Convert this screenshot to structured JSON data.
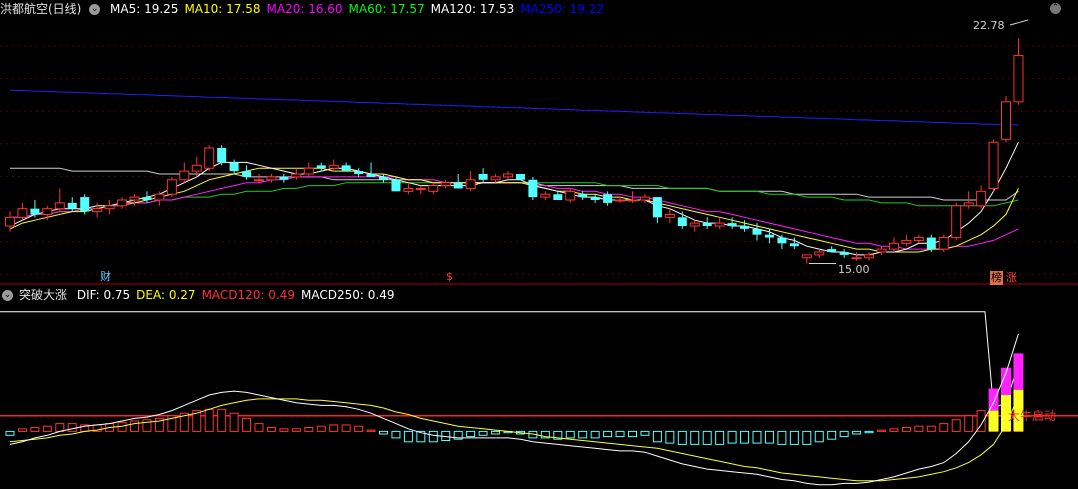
{
  "header": {
    "title": "洪都航空(日线)",
    "ma": [
      {
        "label": "MA5: 19.25",
        "color": "#ffffff"
      },
      {
        "label": "MA10: 17.58",
        "color": "#ffff00"
      },
      {
        "label": "MA20: 16.60",
        "color": "#ff00ff"
      },
      {
        "label": "MA60: 17.57",
        "color": "#00ff00"
      },
      {
        "label": "MA120: 17.53",
        "color": "#ffffff"
      },
      {
        "label": "MA250: 19.22",
        "color": "#0000ff"
      }
    ]
  },
  "indicator": {
    "title": "突破大涨",
    "items": [
      {
        "label": "DIF: 0.75",
        "color": "#ffffff"
      },
      {
        "label": "DEA: 0.27",
        "color": "#ffff00"
      },
      {
        "label": "MACD120: 0.49",
        "color": "#ff3030"
      },
      {
        "label": "MACD250: 0.49",
        "color": "#ffffff"
      }
    ]
  },
  "annotations": {
    "high": "22.78",
    "low": "15.00",
    "cai": "财",
    "dollar": "$",
    "bang": "榜",
    "zhang": "涨",
    "signal": "大牛启动"
  },
  "colors": {
    "up": "#ff3232",
    "down": "#54ffff",
    "grid": "#5a0000",
    "divider": "#b00000"
  },
  "chart_data": {
    "type": "candlestick",
    "ylim": [
      14.5,
      23.5
    ],
    "candles": [
      [
        16.3,
        16.8,
        16.1,
        16.6
      ],
      [
        16.6,
        17.1,
        16.5,
        16.9
      ],
      [
        16.9,
        17.2,
        16.6,
        16.7
      ],
      [
        16.7,
        17.0,
        16.5,
        16.9
      ],
      [
        16.9,
        17.6,
        16.8,
        17.1
      ],
      [
        17.1,
        17.3,
        16.8,
        16.9
      ],
      [
        17.3,
        17.4,
        16.7,
        16.8
      ],
      [
        16.8,
        17.1,
        16.6,
        16.9
      ],
      [
        16.9,
        17.2,
        16.7,
        17.0
      ],
      [
        17.0,
        17.3,
        16.9,
        17.2
      ],
      [
        17.2,
        17.4,
        17.0,
        17.3
      ],
      [
        17.3,
        17.5,
        17.1,
        17.2
      ],
      [
        17.2,
        17.5,
        17.0,
        17.4
      ],
      [
        17.4,
        18.0,
        17.3,
        17.9
      ],
      [
        17.9,
        18.5,
        17.8,
        18.2
      ],
      [
        18.2,
        18.7,
        18.0,
        18.4
      ],
      [
        18.3,
        19.1,
        18.2,
        19.0
      ],
      [
        19.0,
        19.1,
        18.4,
        18.5
      ],
      [
        18.5,
        18.6,
        18.1,
        18.2
      ],
      [
        18.2,
        18.4,
        17.9,
        18.0
      ],
      [
        17.9,
        18.1,
        17.8,
        17.9
      ],
      [
        17.9,
        18.1,
        17.8,
        18.0
      ],
      [
        18.0,
        18.1,
        17.8,
        17.9
      ],
      [
        18.0,
        18.3,
        17.9,
        18.1
      ],
      [
        18.1,
        18.5,
        18.0,
        18.3
      ],
      [
        18.4,
        18.5,
        18.2,
        18.3
      ],
      [
        18.3,
        18.6,
        18.2,
        18.4
      ],
      [
        18.4,
        18.5,
        18.2,
        18.2
      ],
      [
        18.2,
        18.3,
        18.0,
        18.1
      ],
      [
        18.1,
        18.5,
        18.0,
        18.0
      ],
      [
        18.0,
        18.1,
        17.8,
        17.9
      ],
      [
        17.9,
        18.0,
        17.5,
        17.5
      ],
      [
        17.5,
        17.8,
        17.4,
        17.6
      ],
      [
        17.6,
        17.7,
        17.4,
        17.6
      ],
      [
        17.5,
        17.8,
        17.4,
        17.7
      ],
      [
        17.7,
        17.9,
        17.6,
        17.8
      ],
      [
        17.8,
        18.1,
        17.6,
        17.6
      ],
      [
        17.6,
        18.2,
        17.5,
        17.9
      ],
      [
        18.1,
        18.3,
        17.8,
        17.9
      ],
      [
        17.9,
        18.1,
        17.8,
        18.0
      ],
      [
        18.0,
        18.2,
        17.9,
        18.1
      ],
      [
        18.1,
        18.1,
        17.9,
        17.9
      ],
      [
        17.9,
        18.0,
        17.2,
        17.3
      ],
      [
        17.3,
        17.5,
        17.2,
        17.4
      ],
      [
        17.4,
        17.5,
        17.2,
        17.2
      ],
      [
        17.2,
        17.6,
        17.1,
        17.5
      ],
      [
        17.4,
        17.5,
        17.2,
        17.3
      ],
      [
        17.3,
        17.4,
        17.1,
        17.2
      ],
      [
        17.4,
        17.5,
        17.0,
        17.1
      ],
      [
        17.2,
        17.3,
        17.1,
        17.2
      ],
      [
        17.2,
        17.5,
        17.1,
        17.2
      ],
      [
        17.2,
        17.4,
        17.1,
        17.3
      ],
      [
        17.3,
        17.3,
        16.4,
        16.6
      ],
      [
        16.6,
        16.9,
        16.4,
        16.7
      ],
      [
        16.6,
        16.8,
        16.2,
        16.3
      ],
      [
        16.3,
        16.5,
        16.1,
        16.4
      ],
      [
        16.4,
        16.6,
        16.2,
        16.3
      ],
      [
        16.3,
        16.6,
        16.2,
        16.4
      ],
      [
        16.4,
        16.6,
        16.2,
        16.3
      ],
      [
        16.3,
        16.5,
        16.1,
        16.2
      ],
      [
        16.2,
        16.4,
        15.8,
        16.0
      ],
      [
        16.0,
        16.2,
        15.7,
        15.9
      ],
      [
        15.9,
        16.0,
        15.5,
        15.7
      ],
      [
        15.7,
        15.9,
        15.5,
        15.6
      ],
      [
        15.2,
        15.3,
        15.0,
        15.3
      ],
      [
        15.3,
        15.5,
        15.2,
        15.4
      ],
      [
        15.5,
        15.6,
        15.4,
        15.4
      ],
      [
        15.4,
        15.5,
        15.2,
        15.3
      ],
      [
        15.2,
        15.4,
        15.1,
        15.2
      ],
      [
        15.2,
        15.4,
        15.1,
        15.3
      ],
      [
        15.4,
        15.6,
        15.3,
        15.5
      ],
      [
        15.5,
        15.9,
        15.4,
        15.7
      ],
      [
        15.7,
        16.0,
        15.6,
        15.8
      ],
      [
        15.8,
        16.0,
        15.7,
        15.9
      ],
      [
        15.9,
        16.0,
        15.4,
        15.5
      ],
      [
        15.5,
        16.0,
        15.4,
        15.9
      ],
      [
        15.9,
        17.1,
        15.8,
        17.0
      ],
      [
        17.0,
        17.5,
        16.9,
        17.1
      ],
      [
        17.0,
        17.7,
        16.9,
        17.5
      ],
      [
        17.6,
        19.3,
        17.5,
        19.2
      ],
      [
        19.3,
        20.8,
        19.2,
        20.6
      ],
      [
        20.6,
        22.8,
        20.5,
        22.2
      ]
    ],
    "ma5": [
      16.3,
      16.5,
      16.7,
      16.8,
      16.9,
      16.9,
      16.9,
      17.0,
      17.0,
      17.1,
      17.2,
      17.3,
      17.4,
      17.6,
      17.8,
      18.0,
      18.3,
      18.5,
      18.5,
      18.5,
      18.4,
      18.3,
      18.2,
      18.1,
      18.1,
      18.2,
      18.3,
      18.3,
      18.2,
      18.1,
      18.0,
      17.9,
      17.8,
      17.7,
      17.7,
      17.7,
      17.7,
      17.7,
      17.8,
      17.8,
      17.9,
      17.9,
      17.7,
      17.6,
      17.5,
      17.4,
      17.3,
      17.3,
      17.2,
      17.2,
      17.2,
      17.2,
      17.0,
      16.9,
      16.7,
      16.5,
      16.4,
      16.4,
      16.3,
      16.3,
      16.2,
      16.1,
      15.9,
      15.8,
      15.6,
      15.5,
      15.4,
      15.4,
      15.3,
      15.3,
      15.4,
      15.4,
      15.5,
      15.7,
      15.7,
      15.8,
      16.1,
      16.4,
      16.8,
      17.5,
      18.3,
      19.2
    ],
    "ma10": [
      16.2,
      16.4,
      16.5,
      16.6,
      16.7,
      16.8,
      16.8,
      16.9,
      17.0,
      17.1,
      17.1,
      17.2,
      17.3,
      17.4,
      17.5,
      17.7,
      17.9,
      18.0,
      18.1,
      18.2,
      18.3,
      18.3,
      18.3,
      18.3,
      18.3,
      18.3,
      18.2,
      18.2,
      18.2,
      18.1,
      18.1,
      18.0,
      17.9,
      17.9,
      17.8,
      17.8,
      17.8,
      17.8,
      17.8,
      17.8,
      17.8,
      17.8,
      17.7,
      17.6,
      17.5,
      17.5,
      17.4,
      17.4,
      17.3,
      17.3,
      17.2,
      17.2,
      17.1,
      17.0,
      16.9,
      16.8,
      16.7,
      16.6,
      16.5,
      16.4,
      16.3,
      16.2,
      16.1,
      16.0,
      15.9,
      15.8,
      15.7,
      15.6,
      15.5,
      15.5,
      15.4,
      15.4,
      15.4,
      15.4,
      15.5,
      15.5,
      15.6,
      15.8,
      16.0,
      16.3,
      16.7,
      17.6
    ],
    "ma20": [
      16.6,
      16.6,
      16.7,
      16.7,
      16.8,
      16.8,
      16.9,
      16.9,
      17.0,
      17.0,
      17.1,
      17.1,
      17.2,
      17.2,
      17.3,
      17.4,
      17.5,
      17.6,
      17.7,
      17.8,
      17.8,
      17.9,
      17.9,
      18.0,
      18.0,
      18.0,
      18.0,
      18.0,
      18.0,
      18.0,
      18.0,
      18.0,
      17.9,
      17.9,
      17.9,
      17.8,
      17.8,
      17.8,
      17.8,
      17.8,
      17.8,
      17.8,
      17.7,
      17.7,
      17.6,
      17.6,
      17.5,
      17.5,
      17.4,
      17.4,
      17.3,
      17.3,
      17.2,
      17.1,
      17.0,
      16.9,
      16.8,
      16.8,
      16.7,
      16.6,
      16.5,
      16.4,
      16.3,
      16.2,
      16.1,
      16.0,
      15.9,
      15.8,
      15.7,
      15.7,
      15.6,
      15.6,
      15.5,
      15.5,
      15.5,
      15.5,
      15.6,
      15.6,
      15.7,
      15.8,
      16.0,
      16.2
    ],
    "ma60": [
      16.6,
      16.6,
      16.7,
      16.7,
      16.8,
      16.8,
      16.9,
      16.9,
      17.0,
      17.0,
      17.1,
      17.1,
      17.2,
      17.2,
      17.3,
      17.3,
      17.3,
      17.4,
      17.4,
      17.5,
      17.5,
      17.5,
      17.6,
      17.6,
      17.7,
      17.7,
      17.7,
      17.8,
      17.8,
      17.8,
      17.8,
      17.8,
      17.8,
      17.8,
      17.8,
      17.8,
      17.8,
      17.8,
      17.8,
      17.8,
      17.8,
      17.8,
      17.8,
      17.8,
      17.8,
      17.8,
      17.8,
      17.8,
      17.7,
      17.7,
      17.7,
      17.7,
      17.7,
      17.6,
      17.6,
      17.6,
      17.6,
      17.5,
      17.5,
      17.5,
      17.5,
      17.4,
      17.4,
      17.4,
      17.3,
      17.3,
      17.3,
      17.2,
      17.2,
      17.2,
      17.1,
      17.1,
      17.1,
      17.0,
      17.0,
      17.0,
      17.0,
      17.0,
      17.0,
      17.0,
      17.1,
      17.2
    ],
    "ma120": [
      18.3,
      18.3,
      18.3,
      18.3,
      18.3,
      18.2,
      18.2,
      18.2,
      18.2,
      18.2,
      18.2,
      18.2,
      18.1,
      18.1,
      18.1,
      18.1,
      18.1,
      18.1,
      18.1,
      18.0,
      18.0,
      18.0,
      18.0,
      18.0,
      18.0,
      18.0,
      17.9,
      17.9,
      17.9,
      17.9,
      17.9,
      17.9,
      17.9,
      17.9,
      17.8,
      17.8,
      17.8,
      17.8,
      17.8,
      17.8,
      17.8,
      17.8,
      17.8,
      17.7,
      17.7,
      17.7,
      17.7,
      17.7,
      17.7,
      17.7,
      17.6,
      17.6,
      17.6,
      17.6,
      17.6,
      17.6,
      17.6,
      17.5,
      17.5,
      17.5,
      17.5,
      17.5,
      17.5,
      17.4,
      17.4,
      17.4,
      17.4,
      17.4,
      17.4,
      17.3,
      17.3,
      17.3,
      17.3,
      17.3,
      17.3,
      17.2,
      17.2,
      17.2,
      17.2,
      17.2,
      17.2,
      17.5
    ],
    "ma250": [
      21.0,
      20.99,
      20.97,
      20.96,
      20.94,
      20.93,
      20.91,
      20.9,
      20.88,
      20.87,
      20.85,
      20.84,
      20.82,
      20.81,
      20.79,
      20.78,
      20.76,
      20.75,
      20.73,
      20.72,
      20.7,
      20.69,
      20.67,
      20.66,
      20.64,
      20.63,
      20.61,
      20.6,
      20.58,
      20.57,
      20.55,
      20.54,
      20.52,
      20.51,
      20.49,
      20.48,
      20.46,
      20.45,
      20.43,
      20.42,
      20.4,
      20.39,
      20.37,
      20.36,
      20.34,
      20.33,
      20.31,
      20.3,
      20.28,
      20.27,
      20.25,
      20.24,
      20.22,
      20.21,
      20.19,
      20.18,
      20.16,
      20.15,
      20.13,
      20.12,
      20.1,
      20.09,
      20.07,
      20.06,
      20.04,
      20.03,
      20.01,
      20.0,
      19.98,
      19.97,
      19.95,
      19.94,
      19.92,
      19.91,
      19.89,
      19.88,
      19.86,
      19.85,
      19.83,
      19.82,
      19.8,
      19.8
    ],
    "ma120_start": 18.31,
    "macd_ylim": [
      -0.42,
      0.98
    ],
    "macd": [
      -0.03,
      0.02,
      0.03,
      0.04,
      0.06,
      0.06,
      0.05,
      0.05,
      0.06,
      0.07,
      0.08,
      0.09,
      0.1,
      0.12,
      0.14,
      0.16,
      0.17,
      0.17,
      0.14,
      0.1,
      0.06,
      0.03,
      0.02,
      0.02,
      0.03,
      0.04,
      0.05,
      0.05,
      0.04,
      0.01,
      -0.02,
      -0.05,
      -0.08,
      -0.08,
      -0.08,
      -0.07,
      -0.06,
      -0.04,
      -0.03,
      -0.02,
      -0.01,
      -0.02,
      -0.05,
      -0.05,
      -0.06,
      -0.05,
      -0.05,
      -0.05,
      -0.04,
      -0.04,
      -0.04,
      -0.03,
      -0.08,
      -0.09,
      -0.1,
      -0.1,
      -0.1,
      -0.1,
      -0.09,
      -0.09,
      -0.09,
      -0.09,
      -0.1,
      -0.1,
      -0.1,
      -0.08,
      -0.06,
      -0.04,
      -0.02,
      -0.01,
      0.01,
      0.02,
      0.03,
      0.04,
      0.04,
      0.06,
      0.09,
      0.12,
      0.16,
      0.22,
      0.3,
      0.49
    ],
    "dif": [
      -0.1,
      -0.08,
      -0.05,
      -0.03,
      0.0,
      0.02,
      0.04,
      0.05,
      0.06,
      0.08,
      0.1,
      0.11,
      0.13,
      0.16,
      0.2,
      0.24,
      0.28,
      0.3,
      0.31,
      0.3,
      0.28,
      0.26,
      0.24,
      0.22,
      0.21,
      0.2,
      0.2,
      0.19,
      0.17,
      0.14,
      0.1,
      0.06,
      0.02,
      -0.01,
      -0.03,
      -0.04,
      -0.05,
      -0.05,
      -0.05,
      -0.05,
      -0.05,
      -0.06,
      -0.08,
      -0.09,
      -0.1,
      -0.11,
      -0.12,
      -0.13,
      -0.14,
      -0.15,
      -0.15,
      -0.16,
      -0.19,
      -0.22,
      -0.25,
      -0.27,
      -0.29,
      -0.3,
      -0.31,
      -0.32,
      -0.33,
      -0.35,
      -0.37,
      -0.38,
      -0.4,
      -0.41,
      -0.41,
      -0.4,
      -0.4,
      -0.39,
      -0.37,
      -0.35,
      -0.32,
      -0.29,
      -0.27,
      -0.24,
      -0.17,
      -0.08,
      0.05,
      0.22,
      0.45,
      0.75
    ],
    "dea": [
      -0.08,
      -0.07,
      -0.06,
      -0.05,
      -0.03,
      -0.02,
      0.0,
      0.01,
      0.03,
      0.04,
      0.06,
      0.07,
      0.08,
      0.1,
      0.12,
      0.14,
      0.17,
      0.2,
      0.22,
      0.24,
      0.25,
      0.25,
      0.25,
      0.25,
      0.24,
      0.24,
      0.23,
      0.22,
      0.21,
      0.2,
      0.18,
      0.15,
      0.13,
      0.1,
      0.08,
      0.06,
      0.04,
      0.03,
      0.02,
      0.01,
      0.0,
      -0.01,
      -0.02,
      -0.04,
      -0.05,
      -0.06,
      -0.07,
      -0.08,
      -0.09,
      -0.1,
      -0.11,
      -0.12,
      -0.13,
      -0.15,
      -0.17,
      -0.19,
      -0.21,
      -0.23,
      -0.25,
      -0.27,
      -0.28,
      -0.3,
      -0.32,
      -0.33,
      -0.34,
      -0.35,
      -0.36,
      -0.37,
      -0.38,
      -0.38,
      -0.38,
      -0.37,
      -0.36,
      -0.35,
      -0.33,
      -0.31,
      -0.28,
      -0.24,
      -0.18,
      -0.1,
      0.05,
      0.27
    ],
    "bull": [
      0,
      0,
      0,
      0,
      0,
      0,
      0,
      0,
      0,
      0,
      0,
      0,
      0,
      0,
      0,
      0,
      0,
      0,
      0,
      0,
      0,
      0,
      0,
      0,
      0,
      0,
      0,
      0,
      0,
      0,
      0,
      0,
      0,
      0,
      0,
      0,
      0,
      0,
      0,
      0,
      0,
      0,
      0,
      0,
      0,
      0,
      0,
      0,
      0,
      0,
      0,
      0,
      0,
      0,
      0,
      0,
      0,
      0,
      0,
      0,
      0,
      0,
      0,
      0,
      0,
      0,
      0,
      0,
      0,
      0,
      0,
      0,
      0,
      0,
      0,
      0,
      0,
      0,
      0,
      0.33,
      0.49,
      0.6
    ],
    "bull_top": [
      0,
      0,
      0,
      0,
      0,
      0,
      0,
      0,
      0,
      0,
      0,
      0,
      0,
      0,
      0,
      0,
      0,
      0,
      0,
      0,
      0,
      0,
      0,
      0,
      0,
      0,
      0,
      0,
      0,
      0,
      0,
      0,
      0,
      0,
      0,
      0,
      0,
      0,
      0,
      0,
      0,
      0,
      0,
      0,
      0,
      0,
      0,
      0,
      0,
      0,
      0,
      0,
      0,
      0,
      0,
      0,
      0,
      0,
      0,
      0,
      0,
      0,
      0,
      0,
      0,
      0,
      0,
      0,
      0,
      0,
      0,
      0,
      0,
      0,
      0,
      0,
      0,
      0,
      0,
      0.16,
      0.28,
      0.32
    ],
    "ref_line": 0.12
  }
}
